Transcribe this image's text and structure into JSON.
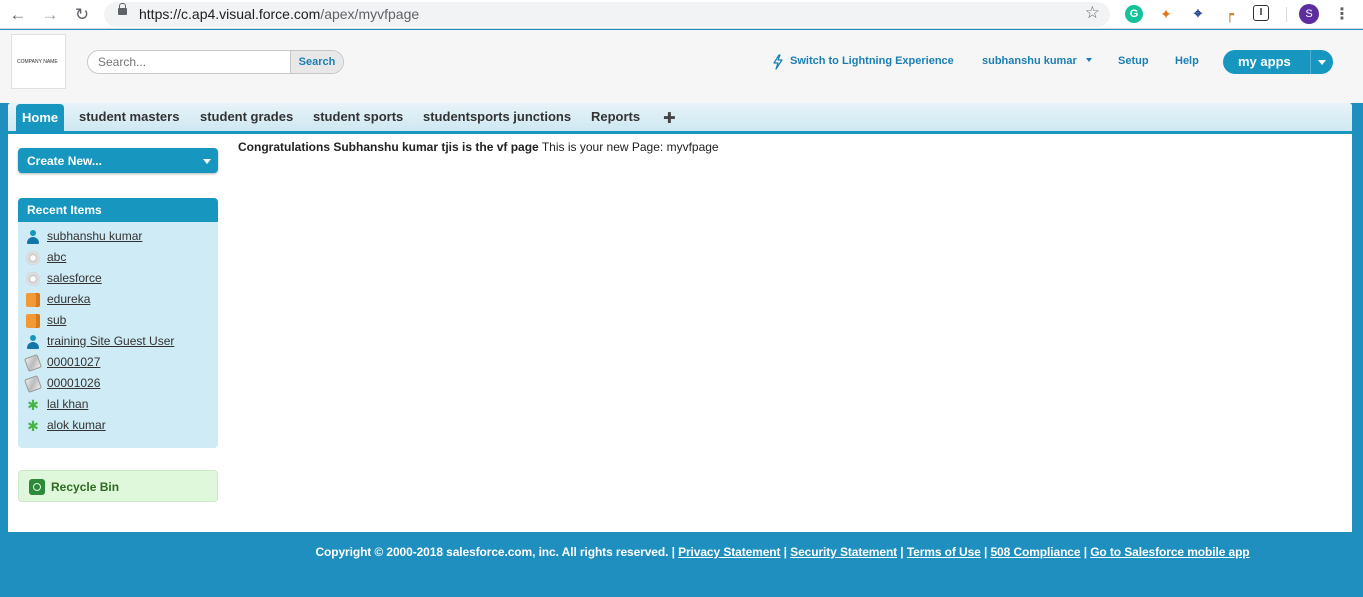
{
  "browser": {
    "url_host": "https://c.ap4.visual.force.com",
    "url_path": "/apex/myvfpage",
    "profile_initial": "S"
  },
  "header": {
    "logo_text": "COMPANY NAME",
    "search_placeholder": "Search...",
    "search_button": "Search",
    "lightning_link": "Switch to Lightning Experience",
    "user_menu": "subhanshu kumar",
    "setup": "Setup",
    "help": "Help",
    "app_menu": "my apps"
  },
  "tabs": [
    {
      "label": "Home",
      "active": true
    },
    {
      "label": "student masters"
    },
    {
      "label": "student grades"
    },
    {
      "label": "student sports"
    },
    {
      "label": "studentsports junctions"
    },
    {
      "label": "Reports"
    }
  ],
  "sidebar": {
    "create_new": "Create New...",
    "recent_title": "Recent Items",
    "recent_items": [
      {
        "label": "subhanshu kumar",
        "icon": "user-icon"
      },
      {
        "label": "abc",
        "icon": "disc-icon"
      },
      {
        "label": "salesforce",
        "icon": "disc-icon"
      },
      {
        "label": "edureka",
        "icon": "book-icon"
      },
      {
        "label": "sub",
        "icon": "book-icon"
      },
      {
        "label": "training Site Guest User",
        "icon": "user-icon"
      },
      {
        "label": "00001027",
        "icon": "document-icon"
      },
      {
        "label": "00001026",
        "icon": "document-icon"
      },
      {
        "label": "lal khan",
        "icon": "runner-icon"
      },
      {
        "label": "alok kumar",
        "icon": "runner-icon"
      }
    ],
    "recycle_bin": "Recycle Bin"
  },
  "content": {
    "bold_text": "Congratulations Subhanshu kumar tjis is the vf page",
    "normal_text": "This is your new Page: myvfpage"
  },
  "footer": {
    "copyright": "Copyright © 2000-2018 salesforce.com, inc. All rights reserved. |",
    "links": [
      "Privacy Statement",
      "Security Statement",
      "Terms of Use",
      "508 Compliance",
      "Go to Salesforce mobile app"
    ]
  },
  "colors": {
    "accent": "#1797c0",
    "footer_bg": "#1f8fbf",
    "recent_bg": "#cfebf5",
    "recycle_bg": "#dff7da"
  }
}
